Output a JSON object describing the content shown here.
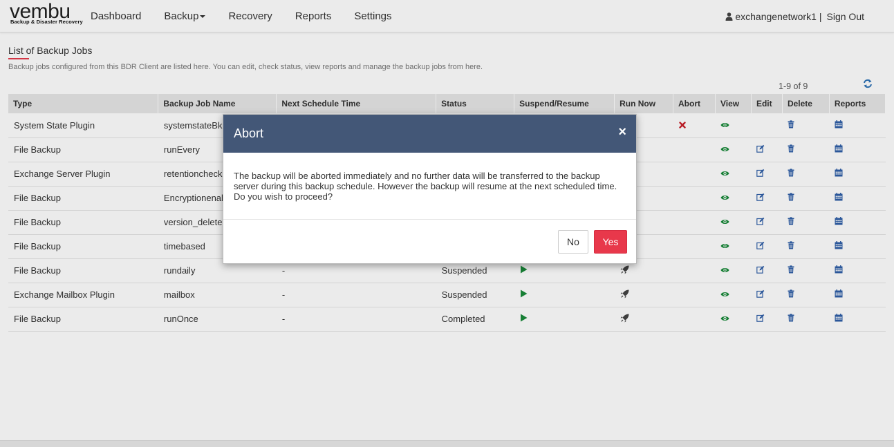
{
  "header": {
    "logo_text": "vembu",
    "logo_tagline": "Backup & Disaster Recovery",
    "nav": [
      {
        "label": "Dashboard"
      },
      {
        "label": "Backup"
      },
      {
        "label": "Recovery"
      },
      {
        "label": "Reports"
      },
      {
        "label": "Settings"
      }
    ],
    "username": "exchangenetwork1",
    "separator": "|",
    "signout": "Sign Out"
  },
  "main": {
    "title": "List of Backup Jobs",
    "description": "Backup jobs configured from this BDR Client are listed here. You can edit, check status, view reports and manage the backup jobs from here.",
    "pager": "1-9 of 9",
    "columns": [
      "Type",
      "Backup Job Name",
      "Next Schedule Time",
      "Status",
      "Suspend/Resume",
      "Run Now",
      "Abort",
      "View",
      "Edit",
      "Delete",
      "Reports"
    ],
    "rows": [
      {
        "type": "System State Plugin",
        "name": "systemstateBkp",
        "next": "",
        "status": "",
        "resume": false,
        "runnow": false,
        "abort": true,
        "edit": false
      },
      {
        "type": "File Backup",
        "name": "runEvery",
        "next": "",
        "status": "",
        "resume": false,
        "runnow": false,
        "abort": false,
        "edit": true
      },
      {
        "type": "Exchange Server Plugin",
        "name": "retentioncheck",
        "next": "",
        "status": "",
        "resume": false,
        "runnow": false,
        "abort": false,
        "edit": true
      },
      {
        "type": "File Backup",
        "name": "Encryptionenabled",
        "next": "",
        "status": "",
        "resume": false,
        "runnow": false,
        "abort": false,
        "edit": true
      },
      {
        "type": "File Backup",
        "name": "version_delete",
        "next": "",
        "status": "",
        "resume": false,
        "runnow": false,
        "abort": false,
        "edit": true
      },
      {
        "type": "File Backup",
        "name": "timebased",
        "next": "",
        "status": "",
        "resume": false,
        "runnow": false,
        "abort": false,
        "edit": true
      },
      {
        "type": "File Backup",
        "name": "rundaily",
        "next": "-",
        "status": "Suspended",
        "resume": true,
        "runnow": true,
        "abort": false,
        "edit": true
      },
      {
        "type": "Exchange Mailbox Plugin",
        "name": "mailbox",
        "next": "-",
        "status": "Suspended",
        "resume": true,
        "runnow": true,
        "abort": false,
        "edit": true
      },
      {
        "type": "File Backup",
        "name": "runOnce",
        "next": "-",
        "status": "Completed",
        "resume": true,
        "runnow": true,
        "abort": false,
        "edit": true
      }
    ]
  },
  "modal": {
    "title": "Abort",
    "close": "×",
    "message": "The backup will be aborted immediately and no further data will be transferred to the backup server during this backup schedule. However the backup will resume at the next scheduled time. Do you wish to proceed?",
    "no_label": "No",
    "yes_label": "Yes"
  },
  "colors": {
    "modal_header": "#435777",
    "yes_button": "#e8384b",
    "icon_green": "#1a8a3a",
    "icon_blue": "#2f5fa8",
    "abort_red": "#c8202a"
  },
  "icons": {
    "user": "user-icon",
    "refresh": "refresh-icon",
    "resume": "play-icon",
    "runnow": "rocket-icon",
    "abort": "abort-x-icon",
    "view": "eye-icon",
    "edit": "edit-icon",
    "delete": "trash-icon",
    "reports": "calendar-icon"
  }
}
